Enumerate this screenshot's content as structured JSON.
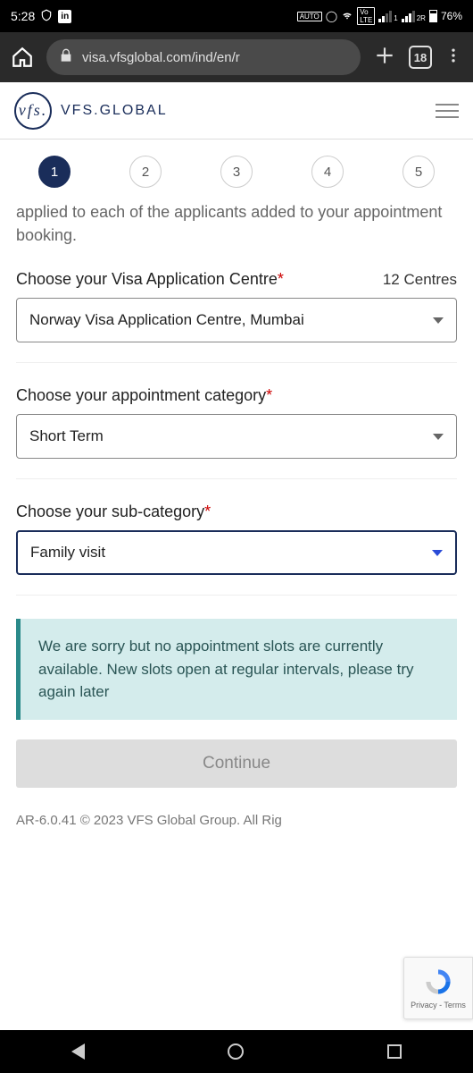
{
  "status": {
    "time": "5:28",
    "battery": "76%",
    "sim1": "1",
    "sim2": "2R"
  },
  "browser": {
    "url": "visa.vfsglobal.com/ind/en/r",
    "tab_count": "18"
  },
  "header": {
    "brand_short": "vfs.",
    "brand_text": "VFS.GLOBAL"
  },
  "stepper": [
    "1",
    "2",
    "3",
    "4",
    "5"
  ],
  "intro": "applied to each of the applicants added to your appointment booking.",
  "fields": {
    "centre": {
      "label": "Choose your Visa Application Centre",
      "count": "12 Centres",
      "value": "Norway Visa Application Centre, Mumbai"
    },
    "category": {
      "label": "Choose your appointment category",
      "value": "Short Term"
    },
    "subcategory": {
      "label": "Choose your sub-category",
      "value": "Family visit"
    }
  },
  "banner": "We are sorry but no appointment slots are currently available. New slots open at regular intervals, please try again later",
  "continue_label": "Continue",
  "footer": "AR-6.0.41 © 2023 VFS Global Group. All Rig",
  "recaptcha": "Privacy - Terms"
}
